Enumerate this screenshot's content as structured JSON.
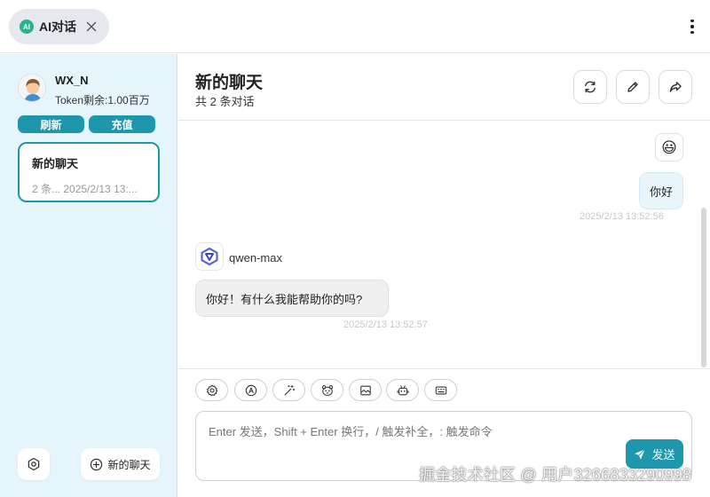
{
  "tab": {
    "title": "AI对话",
    "logo_text": "AI"
  },
  "sidebar": {
    "username": "WX_N",
    "token_text": "Token剩余:1.00百万",
    "refresh_label": "刷新",
    "recharge_label": "充值",
    "conversations": [
      {
        "title": "新的聊天",
        "meta": "2 条... 2025/2/13 13:..."
      }
    ],
    "new_chat_label": "新的聊天"
  },
  "chat": {
    "title": "新的聊天",
    "count_text": "共 2 条对话",
    "messages": [
      {
        "role": "user",
        "avatar": "😃",
        "text": "你好",
        "time": "2025/2/13 13:52:56"
      },
      {
        "role": "assistant",
        "name": "qwen-max",
        "text": "你好！有什么我能帮助你的吗?",
        "time": "2025/2/13 13:52:57"
      }
    ]
  },
  "input": {
    "placeholder": "Enter 发送，Shift + Enter 换行，/ 触发补全，: 触发命令",
    "send_label": "发送"
  },
  "watermark": "掘金技术社区 @ 用户3266833290998",
  "colors": {
    "accent": "#1e97ad",
    "sidebar_bg": "#e6f5fb",
    "user_bubble": "#e8f6fb"
  }
}
